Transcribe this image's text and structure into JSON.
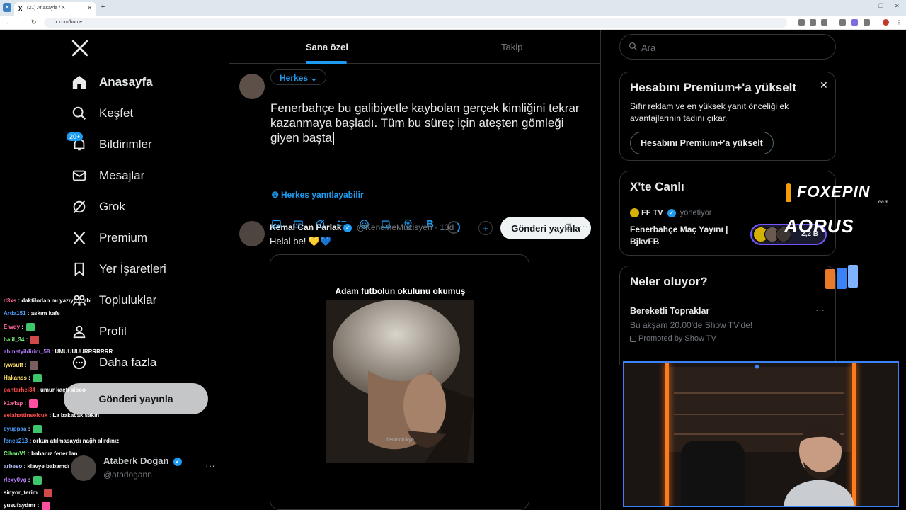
{
  "browser": {
    "tab_title": "(21) Anasayfa / X",
    "url": "x.com/home"
  },
  "nav": {
    "items": [
      {
        "label": "Anasayfa",
        "icon": "home-icon"
      },
      {
        "label": "Keşfet",
        "icon": "search-icon"
      },
      {
        "label": "Bildirimler",
        "icon": "bell-icon"
      },
      {
        "label": "Mesajlar",
        "icon": "mail-icon"
      },
      {
        "label": "Grok",
        "icon": "grok-icon"
      },
      {
        "label": "Premium",
        "icon": "x-icon"
      },
      {
        "label": "Yer İşaretleri",
        "icon": "bookmark-icon"
      },
      {
        "label": "Topluluklar",
        "icon": "communities-icon"
      },
      {
        "label": "Profil",
        "icon": "user-icon"
      },
      {
        "label": "Daha fazla",
        "icon": "more-circle-icon"
      }
    ],
    "notif_badge": "20+",
    "post_button": "Gönderi yayınla"
  },
  "profile": {
    "name": "Ataberk Doğan",
    "handle": "@atadogann",
    "more": "···"
  },
  "feed_tabs": [
    "Sana özel",
    "Takip"
  ],
  "composer": {
    "audience": "Herkes",
    "text": "Fenerbahçe bu galibiyetle kaybolan gerçek kimliğini tekrar kazanmaya başladı. Tüm bu süreç için ateşten gömleği giyen başta",
    "reply_setting": "Herkes yanıtlayabilir",
    "submit": "Gönderi yayınla"
  },
  "post": {
    "author": "Kemal Can Parlak",
    "handle": "@KendineMuzisyen",
    "time": "· 13d",
    "text": "Helal be! 💛💙",
    "media_caption": "Adam futbolun okulunu okumuş",
    "media_watermark": "benmorukyo"
  },
  "search": {
    "placeholder": "Ara"
  },
  "premium_card": {
    "title": "Hesabını Premium+'a yükselt",
    "desc": "Sıfır reklam ve en yüksek yanıt önceliği ek avantajlarının tadını çıkar.",
    "button": "Hesabını Premium+'a yükselt"
  },
  "live_card": {
    "title": "X'te Canlı",
    "host": "FF TV",
    "host_suffix": "yönetiyor",
    "stream_title": "Fenerbahçe Maç Yayını | BjkvFB",
    "listeners": "2,2 B"
  },
  "trends_card": {
    "title": "Neler oluyor?",
    "topic": "Bereketli Topraklar",
    "sub": "Bu akşam 20.00'de Show TV'de!",
    "promo": "Promoted by Show TV"
  },
  "overlays": {
    "foxepin": "FOXEPIN",
    "foxepin_sub": ".com",
    "aorus": "AORUS"
  },
  "chat": [
    {
      "user": "d3xs",
      "msg": "daktilodan mı yazıyo n abi",
      "color": "#ff6b9d"
    },
    {
      "user": "Arda151",
      "msg": "askım kafe",
      "color": "#4ea1ff"
    },
    {
      "user": "Elwdy",
      "msg": "",
      "color": "#ff6b9d"
    },
    {
      "user": "halil_34",
      "msg": "",
      "color": "#7dff7d"
    },
    {
      "user": "ahmetyildirim_58",
      "msg": "UMUUUUURRRRRRR",
      "color": "#b77dff"
    },
    {
      "user": "lywsuff",
      "msg": "",
      "color": "#ffe36b"
    },
    {
      "user": "Hakanss",
      "msg": "",
      "color": "#ffe36b"
    },
    {
      "user": "pantarhei34",
      "msg": "umur kaçtı alooo",
      "color": "#ff4d4d"
    },
    {
      "user": "k1a4ap",
      "msg": "",
      "color": "#ff6b9d"
    },
    {
      "user": "selahattinselcuk",
      "msg": "La bakacak sakın",
      "color": "#ff4d4d"
    },
    {
      "user": "eyuppaa",
      "msg": "",
      "color": "#4ea1ff"
    },
    {
      "user": "fenes213",
      "msg": "orkun atılmasaydı nağh alırdınız",
      "color": "#4ea1ff"
    },
    {
      "user": "CihanV1",
      "msg": "babanız fener lan",
      "color": "#7dff7d"
    },
    {
      "user": "arbeso",
      "msg": "klavye babamdı",
      "color": "#b7c4ff"
    },
    {
      "user": "rlexy0yg",
      "msg": "",
      "color": "#b77dff"
    },
    {
      "user": "sinyor_terim",
      "msg": "",
      "color": "#fff"
    },
    {
      "user": "yusufaydmr",
      "msg": "",
      "color": "#fff"
    }
  ]
}
